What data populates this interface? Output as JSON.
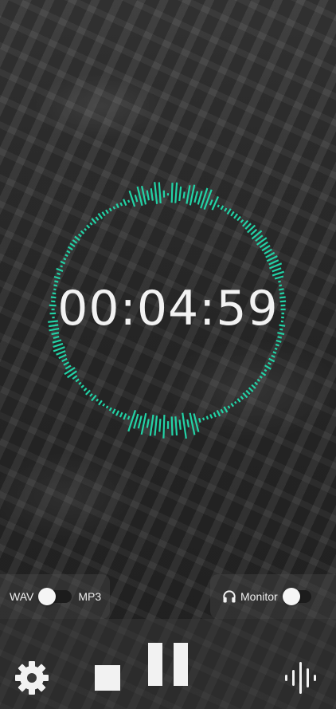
{
  "timer": {
    "elapsed": "00:04:59"
  },
  "format": {
    "left_label": "WAV",
    "right_label": "MP3",
    "selected": "WAV"
  },
  "monitor": {
    "label": "Monitor",
    "enabled": false,
    "icon": "headphones-icon"
  },
  "controls": {
    "settings_icon": "gear-icon",
    "stop_icon": "stop-icon",
    "pause_icon": "pause-icon",
    "waveform_icon": "waveform-icon"
  },
  "colors": {
    "accent": "#22d3a6",
    "text": "#f2f2f2"
  }
}
